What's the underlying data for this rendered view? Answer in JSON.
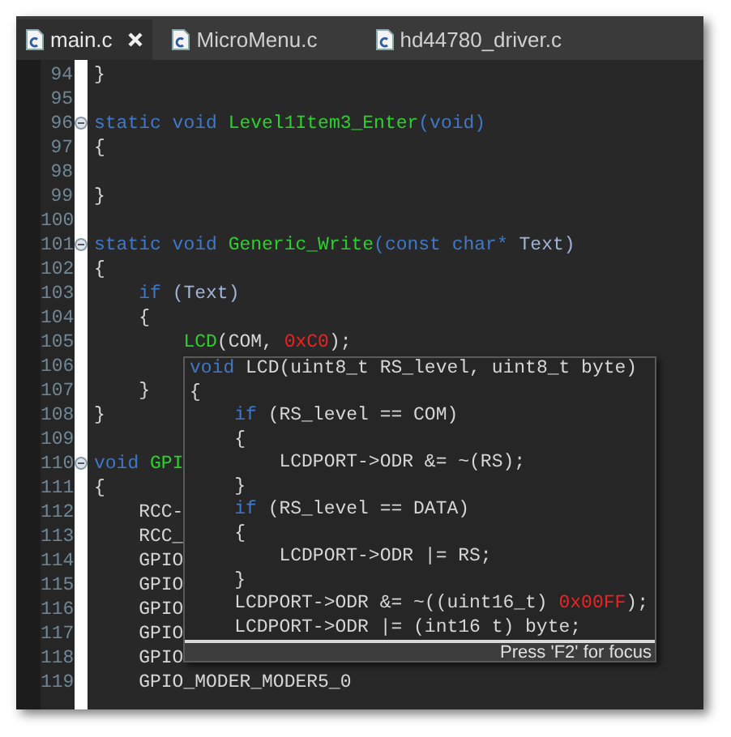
{
  "tabs": [
    {
      "label": "main.c",
      "selected": true
    },
    {
      "label": "MicroMenu.c",
      "selected": false
    },
    {
      "label": "hd44780_driver.c",
      "selected": false
    }
  ],
  "code_lines": [
    {
      "number": "94",
      "fold": false,
      "tokens": [
        {
          "kind": "plain",
          "text": "}"
        }
      ]
    },
    {
      "number": "95",
      "fold": false
    },
    {
      "number": "96",
      "fold": true,
      "tokens": [
        {
          "kind": "keyword",
          "text": "static void "
        },
        {
          "kind": "function",
          "text": "Level1Item3_Enter"
        },
        {
          "kind": "keyword",
          "text": "(void)"
        }
      ]
    },
    {
      "number": "97",
      "fold": false,
      "tokens": [
        {
          "kind": "plain",
          "text": "{"
        }
      ]
    },
    {
      "number": "98",
      "fold": false
    },
    {
      "number": "99",
      "fold": false,
      "tokens": [
        {
          "kind": "plain",
          "text": "}"
        }
      ]
    },
    {
      "number": "100",
      "fold": false
    },
    {
      "number": "101",
      "fold": true,
      "tokens": [
        {
          "kind": "keyword",
          "text": "static void "
        },
        {
          "kind": "function",
          "text": "Generic_Write"
        },
        {
          "kind": "keyword",
          "text": "(const char* "
        },
        {
          "kind": "param",
          "text": "Text)"
        }
      ]
    },
    {
      "number": "102",
      "fold": false,
      "tokens": [
        {
          "kind": "plain",
          "text": "{"
        }
      ]
    },
    {
      "number": "103",
      "fold": false,
      "tokens": [
        {
          "kind": "keyword",
          "text": "    if "
        },
        {
          "kind": "param",
          "text": "(Text)"
        }
      ]
    },
    {
      "number": "104",
      "fold": false,
      "tokens": [
        {
          "kind": "plain",
          "text": "    {"
        }
      ]
    },
    {
      "number": "105",
      "fold": false,
      "tokens": [
        {
          "kind": "function",
          "text": "        LCD"
        },
        {
          "kind": "plain",
          "text": "(COM, "
        },
        {
          "kind": "number",
          "text": "0xC0"
        },
        {
          "kind": "plain",
          "text": ");"
        }
      ]
    },
    {
      "number": "106",
      "fold": false
    },
    {
      "number": "107",
      "fold": false,
      "tokens": [
        {
          "kind": "plain",
          "text": "    }"
        }
      ]
    },
    {
      "number": "108",
      "fold": false,
      "tokens": [
        {
          "kind": "plain",
          "text": "}"
        }
      ]
    },
    {
      "number": "109",
      "fold": false
    },
    {
      "number": "110",
      "fold": true,
      "tokens": [
        {
          "kind": "keyword",
          "text": "void "
        },
        {
          "kind": "function",
          "text": "GPI"
        }
      ]
    },
    {
      "number": "111",
      "fold": false,
      "tokens": [
        {
          "kind": "plain",
          "text": "{"
        }
      ]
    },
    {
      "number": "112",
      "fold": false,
      "tokens": [
        {
          "kind": "plain",
          "text": "    RCC-"
        }
      ]
    },
    {
      "number": "113",
      "fold": false,
      "tokens": [
        {
          "kind": "plain",
          "text": "    RCC_"
        }
      ]
    },
    {
      "number": "114",
      "fold": false,
      "tokens": [
        {
          "kind": "plain",
          "text": "    GPIO"
        }
      ]
    },
    {
      "number": "115",
      "fold": false,
      "tokens": [
        {
          "kind": "plain",
          "text": "    GPIO"
        }
      ]
    },
    {
      "number": "116",
      "fold": false,
      "tokens": [
        {
          "kind": "plain",
          "text": "    GPIO"
        }
      ]
    },
    {
      "number": "117",
      "fold": false,
      "tokens": [
        {
          "kind": "plain",
          "text": "    GPIO"
        }
      ]
    },
    {
      "number": "118",
      "fold": false,
      "tokens": [
        {
          "kind": "plain",
          "text": "    GPIO"
        }
      ]
    },
    {
      "number": "119",
      "fold": false,
      "tokens": [
        {
          "kind": "plain",
          "text": "    GPIO_MODER_MODER5_0"
        }
      ]
    }
  ],
  "hover_popup": {
    "lines": [
      [
        {
          "kind": "keyword",
          "text": "void "
        },
        {
          "kind": "plain",
          "text": "LCD(uint8_t RS_level, uint8_t byte)"
        }
      ],
      [
        {
          "kind": "plain",
          "text": "{"
        }
      ],
      [
        {
          "kind": "keyword",
          "text": "    if "
        },
        {
          "kind": "plain",
          "text": "(RS_level == COM)"
        }
      ],
      [
        {
          "kind": "plain",
          "text": "    {"
        }
      ],
      [
        {
          "kind": "plain",
          "text": "        LCDPORT->ODR &= ~(RS);"
        }
      ],
      [
        {
          "kind": "plain",
          "text": "    }"
        }
      ],
      [
        {
          "kind": "keyword",
          "text": "    if "
        },
        {
          "kind": "plain",
          "text": "(RS_level == DATA)"
        }
      ],
      [
        {
          "kind": "plain",
          "text": "    {"
        }
      ],
      [
        {
          "kind": "plain",
          "text": "        LCDPORT->ODR |= RS;"
        }
      ],
      [
        {
          "kind": "plain",
          "text": "    }"
        }
      ],
      [
        {
          "kind": "plain",
          "text": "    LCDPORT->ODR &= ~((uint16_t) "
        },
        {
          "kind": "number",
          "text": "0x00FF"
        },
        {
          "kind": "plain",
          "text": ");"
        }
      ],
      [
        {
          "kind": "plain",
          "text": "    LCDPORT->ODR |= (int16 t) byte;"
        }
      ]
    ],
    "status": "Press 'F2' for focus"
  }
}
